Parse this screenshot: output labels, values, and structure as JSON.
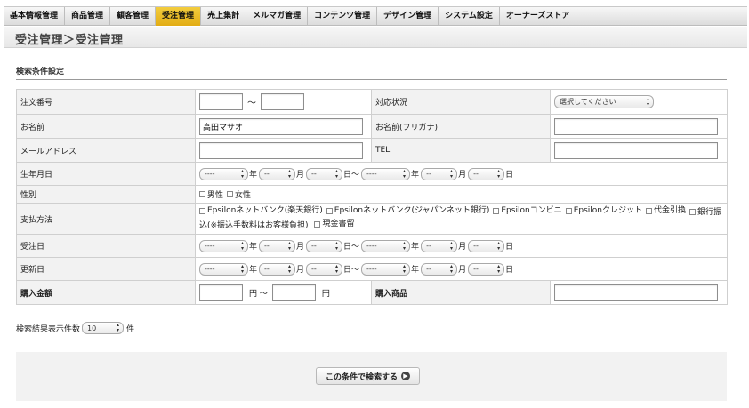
{
  "nav": [
    {
      "label": "基本情報管理",
      "active": false
    },
    {
      "label": "商品管理",
      "active": false
    },
    {
      "label": "顧客管理",
      "active": false
    },
    {
      "label": "受注管理",
      "active": true
    },
    {
      "label": "売上集計",
      "active": false
    },
    {
      "label": "メルマガ管理",
      "active": false
    },
    {
      "label": "コンテンツ管理",
      "active": false
    },
    {
      "label": "デザイン管理",
      "active": false
    },
    {
      "label": "システム設定",
      "active": false
    },
    {
      "label": "オーナーズストア",
      "active": false
    }
  ],
  "page_title": "受注管理＞受注管理",
  "section_title": "検索条件設定",
  "form": {
    "order_no_label": "注文番号",
    "tilde": "〜",
    "status_label": "対応状況",
    "status_value": "選択してください",
    "name_label": "お名前",
    "name_value": "高田マサオ",
    "kana_label": "お名前(フリガナ)",
    "mail_label": "メールアドレス",
    "tel_label": "TEL",
    "birth_label": "生年月日",
    "gender_label": "性別",
    "gender_options": [
      "男性",
      "女性"
    ],
    "payment_label": "支払方法",
    "payment_options": [
      "Epsilonネットバンク(楽天銀行)",
      "Epsilonネットバンク(ジャパンネット銀行)",
      "Epsilonコンビニ",
      "Epsilonクレジット",
      "代金引換",
      "銀行振込(※振込手数料はお客様負担)",
      "現金書留"
    ],
    "order_date_label": "受注日",
    "update_date_label": "更新日",
    "amount_label": "購入金額",
    "yen_tilde": "円 〜",
    "yen": "円",
    "product_label": "購入商品",
    "dash": "----",
    "dashdash": "--",
    "year": "年",
    "month": "月",
    "day": "日",
    "day_tilde": "日〜"
  },
  "display_count": {
    "label": "検索結果表示件数",
    "value": "10",
    "unit": "件"
  },
  "search_button_label": "この条件で検索する",
  "icons": {
    "select_arrows": "updown-arrows-icon",
    "search_arrow": "arrow-right-circle-icon"
  },
  "colors": {
    "active_tab": "#e8b820",
    "label_bg": "#f2f2f2"
  }
}
